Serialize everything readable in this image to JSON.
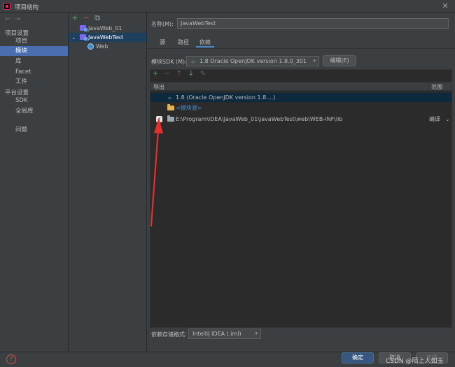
{
  "window": {
    "title": "项目结构",
    "close": "✕"
  },
  "nav": {
    "back": "←",
    "forward": "→",
    "project_settings_header": "项目设置",
    "project_settings": [
      "项目",
      "模块",
      "库",
      "Facet",
      "工件"
    ],
    "platform_settings_header": "平台设置",
    "platform_settings": [
      "SDK",
      "全局库"
    ],
    "problems": "问题",
    "selected": "模块"
  },
  "tree": {
    "toolbar": {
      "add": "+",
      "remove": "−",
      "copy": "⧉"
    },
    "items": [
      {
        "label": "JavaWeb_01",
        "icon": "module-icon",
        "level": 0
      },
      {
        "label": "JavaWebTest",
        "icon": "module-icon",
        "level": 0,
        "expanded": true
      },
      {
        "label": "Web",
        "icon": "web-facet-icon",
        "level": 1
      }
    ]
  },
  "main": {
    "name_label": "名称(M):",
    "name_value": "JavaWebTest",
    "tabs": [
      "源",
      "路径",
      "依赖"
    ],
    "active_tab": "依赖",
    "sdk_label": "模块SDK (M):",
    "sdk_value": "1.8  Oracle OpenJDK version 1.8.0_301",
    "edit_button": "编辑(E)",
    "dep_toolbar": [
      "+",
      "−",
      "↑",
      "↓",
      "✎"
    ],
    "columns": {
      "export": "导出",
      "scope": "范围"
    },
    "dependencies": [
      {
        "label": "1.8 (Oracle OpenJDK version 1.8....)",
        "icon": "jdk-icon",
        "checked": null,
        "scope": ""
      },
      {
        "label": "<模块源>",
        "icon": "folder-icon",
        "checked": null,
        "scope": ""
      },
      {
        "label": "E:\\Program\\IDEA\\JavaWeb_01\\JavaWebTest\\web\\WEB-INF\\lib",
        "icon": "folder-icon",
        "checked": true,
        "scope": "编译"
      }
    ],
    "storage_label": "依赖存储格式:",
    "storage_value": "IntelliJ IDEA (.iml)"
  },
  "footer": {
    "help": "?",
    "ok": "确定",
    "cancel": "取消",
    "apply": "应用",
    "watermark": "CSDN @陌上人如玉"
  },
  "colors": {
    "accent": "#4b6eaf",
    "selection_row": "#0d293e",
    "ok_button": "#365880",
    "arrow": "#e03030",
    "link_text": "#4a88c7"
  }
}
